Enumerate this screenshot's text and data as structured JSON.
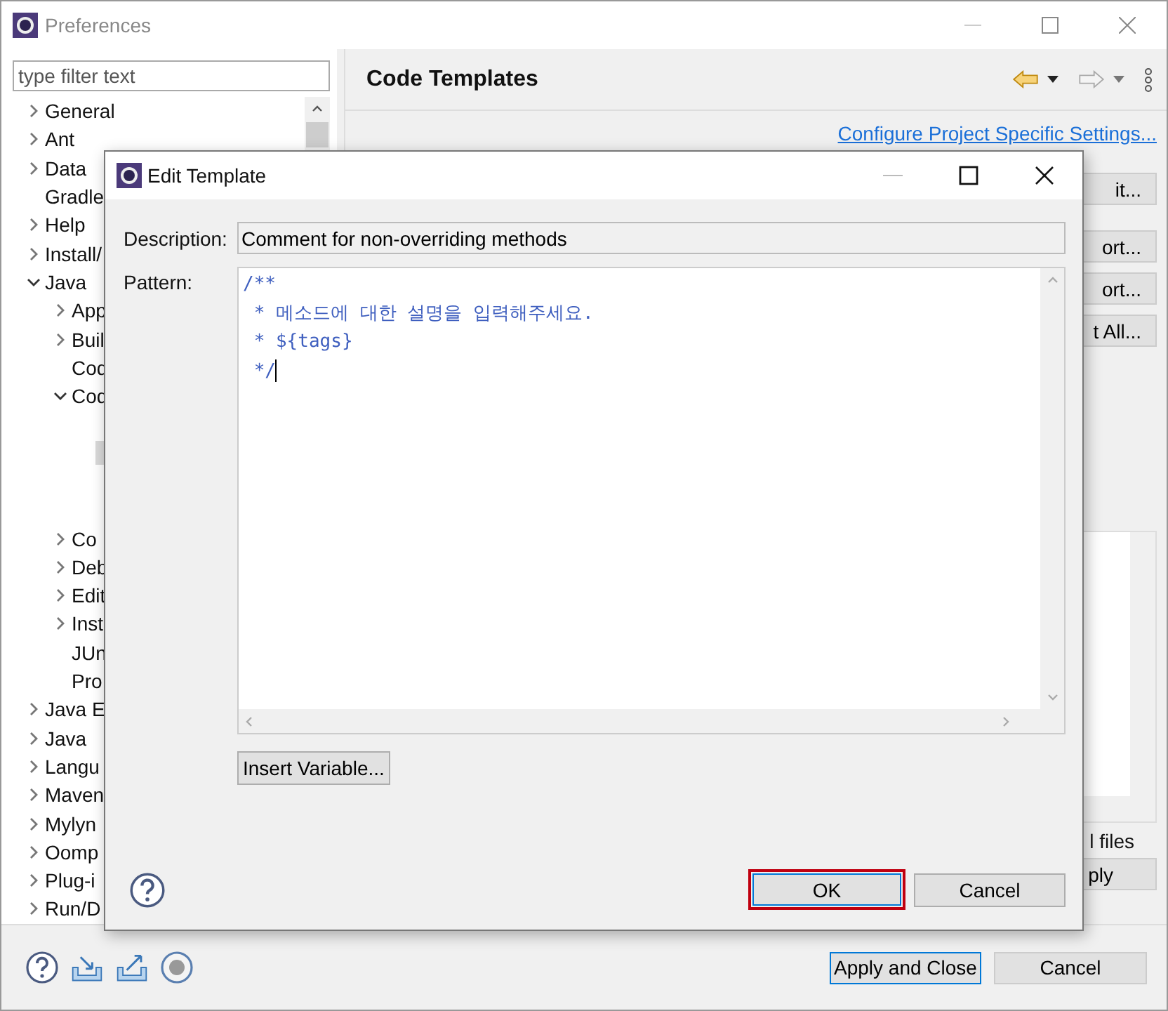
{
  "window": {
    "title": "Preferences"
  },
  "filter": {
    "placeholder": "type filter text"
  },
  "tree": [
    {
      "label": "General",
      "expanded": false,
      "selected": false
    },
    {
      "label": "Ant",
      "expanded": false,
      "selected": false
    },
    {
      "label": "Data",
      "expanded": false,
      "selected": false
    },
    {
      "label": "Gradle",
      "selected": false
    },
    {
      "label": "Help",
      "expanded": false,
      "selected": false
    },
    {
      "label": "Install/",
      "expanded": false,
      "selected": false
    },
    {
      "label": "Java",
      "expanded": true,
      "selected": false,
      "children": [
        {
          "label": "App",
          "expanded": false,
          "selected": false
        },
        {
          "label": "Buil",
          "expanded": false,
          "selected": false
        },
        {
          "label": "Cod",
          "selected": false
        },
        {
          "label": "Cod",
          "expanded": true,
          "selected": false,
          "children": [
            {
              "selected": false
            },
            {
              "selected": true
            },
            {
              "selected": false
            },
            {
              "selected": false
            }
          ]
        },
        {
          "label": "Co",
          "expanded": false,
          "selected": false
        },
        {
          "label": "Deb",
          "expanded": false,
          "selected": false
        },
        {
          "label": "Edit",
          "expanded": false,
          "selected": false
        },
        {
          "label": "Inst",
          "expanded": false,
          "selected": false
        },
        {
          "label": "JUn",
          "selected": false
        },
        {
          "label": "Pro",
          "selected": false
        }
      ]
    },
    {
      "label": "Java E",
      "expanded": false,
      "selected": false
    },
    {
      "label": "Java",
      "expanded": false,
      "selected": false
    },
    {
      "label": "Langu",
      "expanded": false,
      "selected": false
    },
    {
      "label": "Maven",
      "expanded": false,
      "selected": false
    },
    {
      "label": "Mylyn",
      "expanded": false,
      "selected": false
    },
    {
      "label": "Oomp",
      "expanded": false,
      "selected": false
    },
    {
      "label": "Plug-i",
      "expanded": false,
      "selected": false
    },
    {
      "label": "Run/D",
      "expanded": false,
      "selected": false
    }
  ],
  "page": {
    "title": "Code Templates",
    "link": "Configure Project Specific Settings...",
    "side_buttons": [
      "it...",
      "ort...",
      "ort...",
      "t All..."
    ],
    "option_text": "l files",
    "apply_button": "ply"
  },
  "footer": {
    "buttons": [
      {
        "label": "Apply and Close",
        "default": true
      },
      {
        "label": "Cancel",
        "default": false
      }
    ]
  },
  "dialog": {
    "title": "Edit Template",
    "description_label": "Description:",
    "description": "Comment for non-overriding methods",
    "pattern_label": "Pattern:",
    "pattern_lines": [
      "/**",
      " * 메소드에 대한 설명을 입력해주세요.",
      " * ${tags}",
      " */"
    ],
    "insert_button": "Insert Variable...",
    "buttons": [
      {
        "label": "OK",
        "default": true,
        "highlighted": true
      },
      {
        "label": "Cancel",
        "default": false,
        "highlighted": false
      }
    ]
  }
}
